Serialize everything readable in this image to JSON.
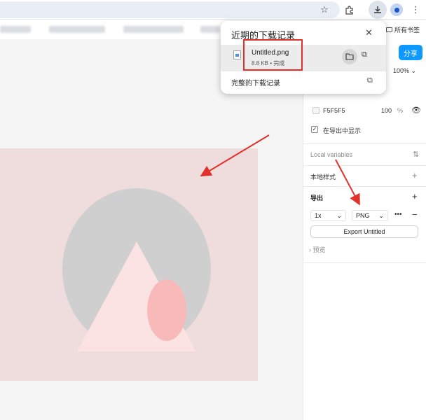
{
  "toolbar": {
    "icons": [
      "star-icon",
      "extension-icon",
      "download-icon",
      "profile-icon",
      "more-icon"
    ],
    "all_bookmarks": "所有书签"
  },
  "download_popup": {
    "title": "近期的下载记录",
    "item": {
      "filename": "Untitled.png",
      "meta": "8.8 KB • 完成"
    },
    "full_history": "完整的下载记录"
  },
  "panel": {
    "share_label": "分享",
    "zoom": "100%",
    "fill": {
      "hex": "F5F5F5",
      "opacity": "100",
      "percent": "%"
    },
    "show_in_export": "在导出中显示",
    "local_variables": "Local variables",
    "local_styles": "本地样式",
    "export": {
      "heading": "导出",
      "scale": "1x",
      "format": "PNG",
      "button": "Export Untitled",
      "preview": "预览"
    }
  },
  "colors": {
    "accent": "#0d99ff",
    "annotation": "#e0312a",
    "frame": "#efdcdc",
    "circle": "#cfcfcf",
    "triangle": "#fbe3e3",
    "ellipse": "#f8b9b9"
  }
}
